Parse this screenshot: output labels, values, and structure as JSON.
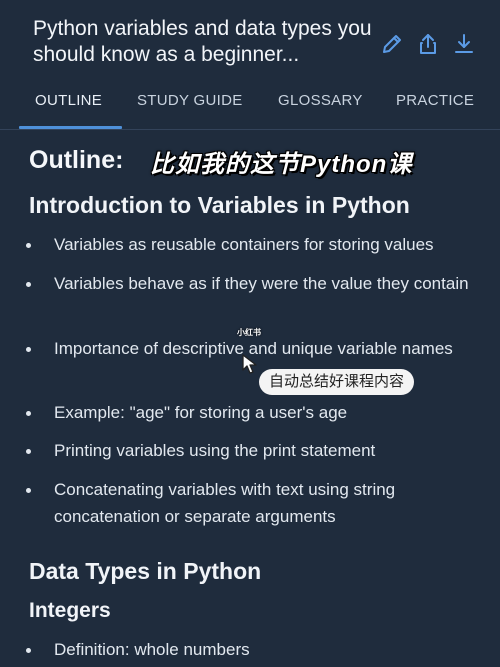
{
  "header": {
    "title": "Python variables and data types you should know as a beginner...",
    "icons": [
      "edit-icon",
      "share-icon",
      "download-icon"
    ]
  },
  "tabs": [
    {
      "label": "OUTLINE",
      "active": true
    },
    {
      "label": "STUDY GUIDE",
      "active": false
    },
    {
      "label": "GLOSSARY",
      "active": false
    },
    {
      "label": "PRACTICE",
      "active": false
    }
  ],
  "content": {
    "outline_label": "Outline:",
    "overlay_caption": "比如我的这节Python课",
    "section1": {
      "heading": "Introduction to Variables in Python",
      "bullets": [
        "Variables as reusable containers for storing values",
        "Variables behave as if they were the value they contain",
        "Importance of descriptive and unique variable names",
        "Example: \"age\" for storing a user's age",
        "Printing variables using the print statement",
        "Concatenating variables with text using string concatenation or separate arguments"
      ]
    },
    "section2": {
      "heading": "Data Types in Python",
      "subheading": "Integers",
      "bullets": [
        "Definition: whole numbers"
      ]
    }
  },
  "watermark": {
    "brand": "小红书",
    "pill_text": "自动总结好课程内容"
  },
  "colors": {
    "background": "#1f2c3d",
    "accent": "#4e90d9",
    "icon": "#5b9be6"
  }
}
